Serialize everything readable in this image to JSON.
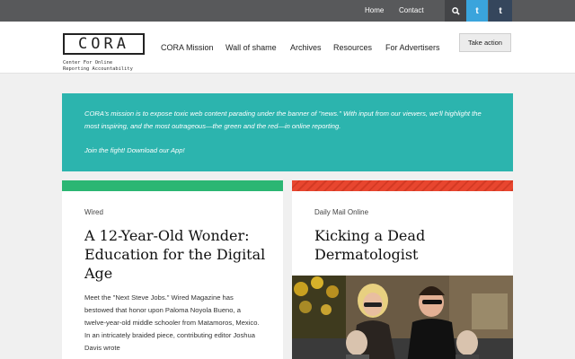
{
  "topbar": {
    "links": [
      "Home",
      "Contact"
    ],
    "icons": [
      "search-icon",
      "twitter-icon",
      "tumblr-icon"
    ],
    "twitter_glyph": "t",
    "tumblr_glyph": "t"
  },
  "header": {
    "logo": "CORA",
    "tagline_line1": "Center For Online",
    "tagline_line2": "Reporting Accountability",
    "nav": [
      "CORA Mission",
      "Wall of shame",
      "Archives",
      "Resources",
      "For Advertisers"
    ],
    "cta": "Take action"
  },
  "mission": {
    "text": "CORA's mission is to expose toxic web content parading under the banner of \"news.\" With input from our viewers, we'll highlight the most inspiring, and the most outrageous—the green and the red—in online reporting.",
    "cta": "Join the fight! Download our App!"
  },
  "cards": [
    {
      "source": "Wired",
      "headline": "A 12-Year-Old Wonder: Education for the Digital Age",
      "excerpt": "Meet the \"Next Steve Jobs.\" Wired Magazine has bestowed that honor upon Paloma Noyola Bueno, a twelve-year-old middle schooler from Matamoros, Mexico. In an intricately braided piece, contributing editor Joshua Davis wrote"
    },
    {
      "source": "Daily Mail Online",
      "headline": "Kicking a Dead Dermatologist",
      "image": "family-photo"
    }
  ],
  "colors": {
    "topbar": "#58595b",
    "mission_bg": "#2cb4ae",
    "green": "#2bb673",
    "red": "#e8462f",
    "twitter": "#3aa4dc",
    "tumblr": "#35465c"
  }
}
